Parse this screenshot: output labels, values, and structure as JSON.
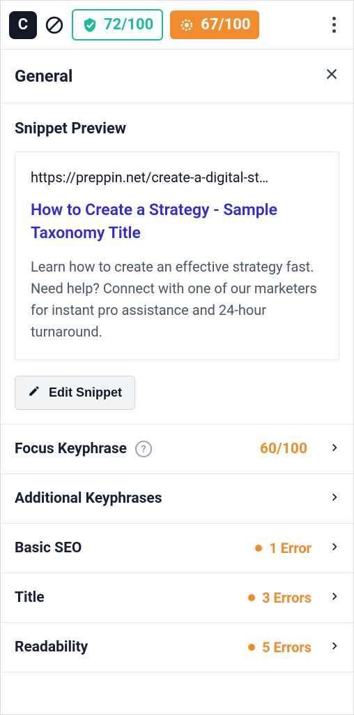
{
  "header": {
    "logo_letter": "C",
    "score_green": "72/100",
    "score_orange": "67/100"
  },
  "section": {
    "title": "General"
  },
  "snippet": {
    "heading": "Snippet Preview",
    "url": "https://preppin.net/create-a-digital-st…",
    "title": "How to Create a Strategy - Sample Taxonomy Title",
    "description": "Learn how to create an effective strategy fast. Need help? Connect with one of our marketers for instant pro assistance and 24-hour turnaround.",
    "edit_label": "Edit Snippet"
  },
  "rows": {
    "focus_keyphrase": {
      "label": "Focus Keyphrase",
      "score": "60/100"
    },
    "additional_keyphrases": {
      "label": "Additional Keyphrases"
    },
    "basic_seo": {
      "label": "Basic SEO",
      "errors": "1 Error"
    },
    "title": {
      "label": "Title",
      "errors": "3 Errors"
    },
    "readability": {
      "label": "Readability",
      "errors": "5 Errors"
    }
  }
}
